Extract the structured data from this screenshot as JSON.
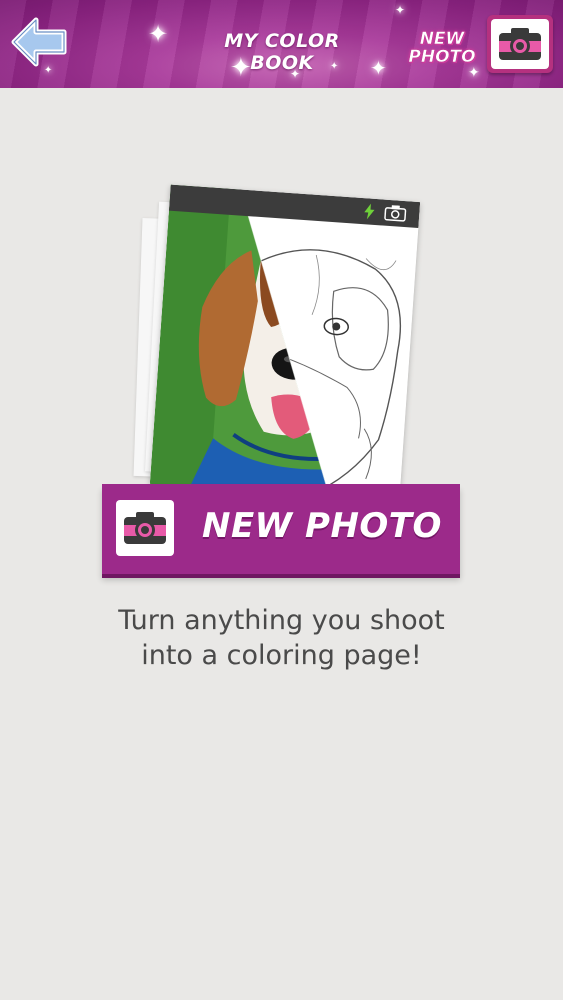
{
  "header": {
    "title": "MY COLOR BOOK",
    "new_photo_label_line1": "NEW",
    "new_photo_label_line2": "PHOTO"
  },
  "main": {
    "new_photo_button_label": "NEW PHOTO",
    "caption_line1": "Turn anything you shoot",
    "caption_line2": "into a coloring page!"
  },
  "icons": {
    "back": "back-arrow-icon",
    "camera": "camera-icon",
    "flash": "flash-icon",
    "switch_camera": "switch-camera-icon"
  },
  "colors": {
    "brand_purple": "#9c2a8a",
    "header_magenta": "#a8399a",
    "camera_pink": "#e85aa8",
    "background": "#e9e8e6",
    "caption_text": "#4a4a4a"
  }
}
